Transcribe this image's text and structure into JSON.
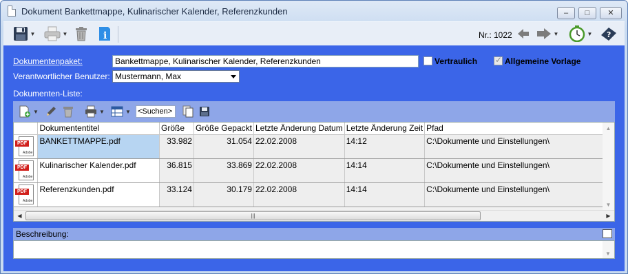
{
  "window": {
    "title": "Dokument Bankettmappe, Kulinarischer Kalender, Referenzkunden",
    "minimize": "–",
    "maximize": "□",
    "close": "✕"
  },
  "toolbar": {
    "save_icon": "floppy-disk-icon",
    "print_icon": "printer-icon",
    "delete_icon": "trash-icon",
    "info_icon": "info-icon",
    "nr_label": "Nr.: 1022",
    "back_icon": "arrow-left-icon",
    "forward_icon": "arrow-right-icon",
    "clock_icon": "clock-icon",
    "help_icon": "help-icon"
  },
  "form": {
    "package_label": "Dokumentenpaket:",
    "package_value": "Bankettmappe, Kulinarischer Kalender, Referenzkunden",
    "confidential_label": "Vertraulich",
    "confidential_checked": false,
    "template_label": "Allgemeine Vorlage",
    "template_checked": true,
    "user_label": "Verantwortlicher Benutzer:",
    "user_value": "Mustermann, Max",
    "doclist_label": "Dokumenten-Liste:"
  },
  "doc_toolbar": {
    "search_placeholder": "<Suchen>"
  },
  "grid": {
    "columns": [
      "",
      "Dokumententitel",
      "Größe",
      "Größe Gepackt",
      "Letzte Änderung Datum",
      "Letzte Änderung Zeit",
      "Pfad"
    ],
    "rows": [
      {
        "title": "BANKETTMAPPE.pdf",
        "size": "33.982",
        "packed": "31.054",
        "date": "22.02.2008",
        "time": "14:12",
        "path": "C:\\Dokumente und Einstellungen\\",
        "selected": true
      },
      {
        "title": "Kulinarischer Kalender.pdf",
        "size": "36.815",
        "packed": "33.869",
        "date": "22.02.2008",
        "time": "14:14",
        "path": "C:\\Dokumente und Einstellungen\\",
        "selected": false
      },
      {
        "title": "Referenzkunden.pdf",
        "size": "33.124",
        "packed": "30.179",
        "date": "22.02.2008",
        "time": "14:14",
        "path": "C:\\Dokumente und Einstellungen\\",
        "selected": false
      }
    ],
    "pdf_tag": "PDF",
    "pdf_brand": "Adobe"
  },
  "description": {
    "label": "Beschreibung:",
    "value": ""
  }
}
